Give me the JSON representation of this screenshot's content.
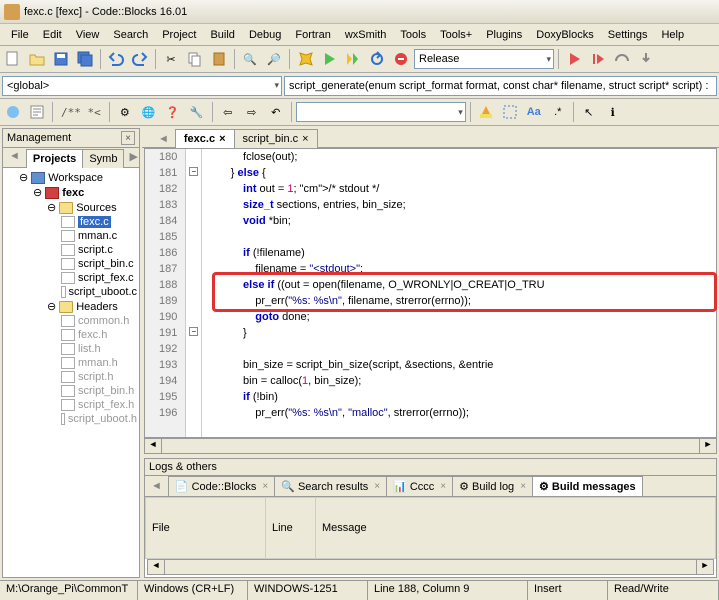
{
  "window": {
    "title": "fexc.c [fexc] - Code::Blocks 16.01"
  },
  "menu": [
    "File",
    "Edit",
    "View",
    "Search",
    "Project",
    "Build",
    "Debug",
    "Fortran",
    "wxSmith",
    "Tools",
    "Tools+",
    "Plugins",
    "DoxyBlocks",
    "Settings",
    "Help"
  ],
  "build_config": "Release",
  "scope_combo": "<global>",
  "signature": "script_generate(enum script_format format, const char* filename, struct script* script) :",
  "comment_label": "/** *<",
  "management": {
    "title": "Management",
    "tabs": [
      "Projects",
      "Symb"
    ],
    "workspace": "Workspace",
    "project": "fexc",
    "folders": [
      "Sources",
      "Headers"
    ],
    "sources": [
      "fexc.c",
      "mman.c",
      "script.c",
      "script_bin.c",
      "script_fex.c",
      "script_uboot.c"
    ],
    "headers": [
      "common.h",
      "fexc.h",
      "list.h",
      "mman.h",
      "script.h",
      "script_bin.h",
      "script_fex.h",
      "script_uboot.h"
    ]
  },
  "editor": {
    "tabs": [
      {
        "name": "fexc.c",
        "active": true
      },
      {
        "name": "script_bin.c",
        "active": false
      }
    ],
    "first_line": 180,
    "lines": [
      "            fclose(out);",
      "        } else {",
      "            int out = 1; /* stdout */",
      "            size_t sections, entries, bin_size;",
      "            void *bin;",
      "",
      "            if (!filename)",
      "                filename = \"<stdout>\";",
      "            else if ((out = open(filename, O_WRONLY|O_CREAT|O_TRU",
      "                pr_err(\"%s: %s\\n\", filename, strerror(errno));",
      "                goto done;",
      "            }",
      "",
      "            bin_size = script_bin_size(script, &sections, &entrie",
      "            bin = calloc(1, bin_size);",
      "            if (!bin)",
      "                pr_err(\"%s: %s\\n\", \"malloc\", strerror(errno));"
    ],
    "highlighted_line": 188
  },
  "logs": {
    "title": "Logs & others",
    "tabs": [
      "Code::Blocks",
      "Search results",
      "Cccc",
      "Build log",
      "Build messages"
    ],
    "active": "Build messages",
    "cols": [
      "File",
      "Line",
      "Message"
    ]
  },
  "status": {
    "path": "M:\\Orange_Pi\\CommonT",
    "eol": "Windows (CR+LF)",
    "enc": "WINDOWS-1251",
    "pos": "Line 188, Column 9",
    "mode": "Insert",
    "rw": "Read/Write"
  },
  "chart_data": null
}
